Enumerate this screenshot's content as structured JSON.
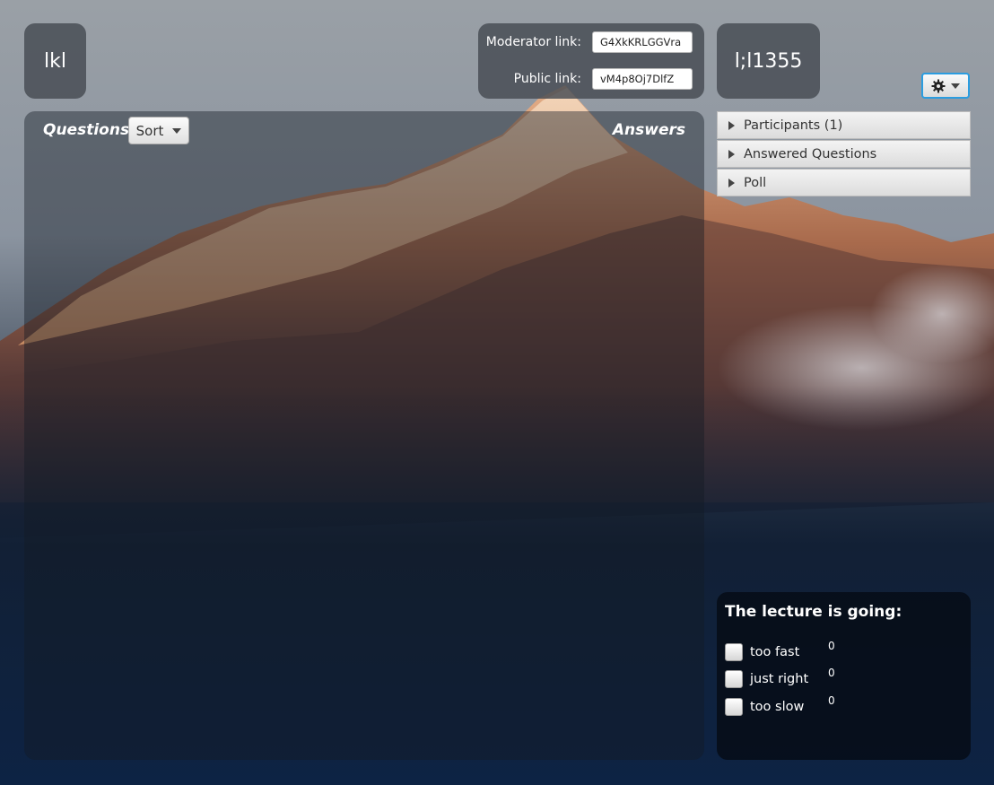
{
  "room": {
    "name": "lkl"
  },
  "room_id": {
    "code": "l;l1355"
  },
  "links": {
    "moderator_label": "Moderator link:",
    "moderator_value": "G4XkKRLGGVra",
    "public_label": "Public link:",
    "public_value": "vM4p8Oj7DlfZ"
  },
  "settings": {
    "icon": "gear-icon"
  },
  "questions_panel": {
    "questions_heading": "Questions",
    "sort_label": "Sort",
    "answers_heading": "Answers"
  },
  "sidebar": {
    "items": [
      {
        "label": "Participants (1)"
      },
      {
        "label": "Answered Questions"
      },
      {
        "label": "Poll"
      }
    ]
  },
  "poll": {
    "title": "The lecture is going:",
    "options": [
      {
        "label": "too fast",
        "count": "0"
      },
      {
        "label": "just right",
        "count": "0"
      },
      {
        "label": "too slow",
        "count": "0"
      }
    ]
  },
  "colors": {
    "accent": "#2b9de0"
  }
}
